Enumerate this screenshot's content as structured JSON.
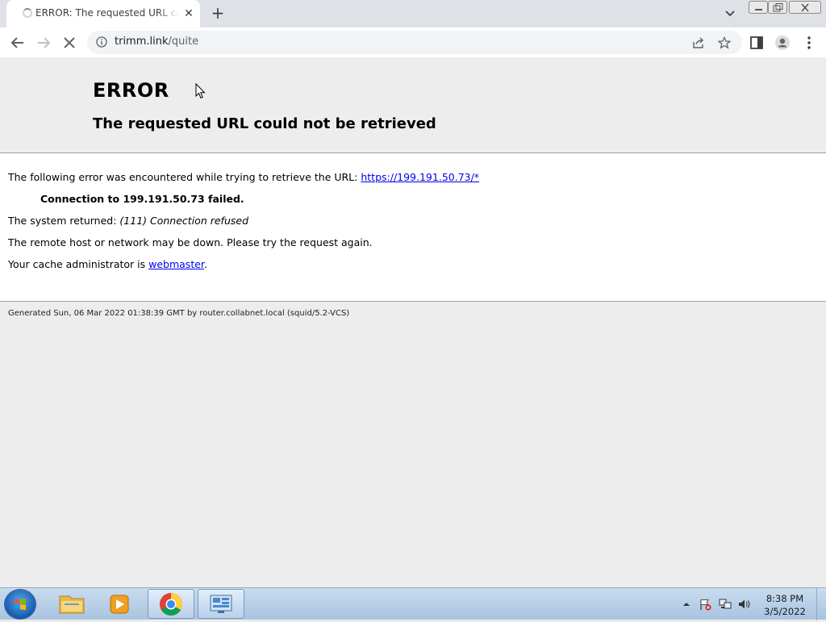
{
  "browser": {
    "tab_title": "ERROR: The requested URL could not be retrieved",
    "url_host": "trimm.link",
    "url_path": "/quite"
  },
  "page": {
    "heading": "ERROR",
    "subheading": "The requested URL could not be retrieved",
    "line1_prefix": "The following error was encountered while trying to retrieve the URL: ",
    "line1_link": "https://199.191.50.73/*",
    "line2": "Connection to 199.191.50.73 failed.",
    "line3_prefix": "The system returned: ",
    "line3_value": "(111) Connection refused",
    "line4": "The remote host or network may be down. Please try the request again.",
    "line5_prefix": "Your cache administrator is ",
    "line5_link": "webmaster",
    "line5_suffix": ".",
    "footer": "Generated Sun, 06 Mar 2022 01:38:39 GMT by router.collabnet.local (squid/5.2-VCS)"
  },
  "taskbar": {
    "apps": [
      "windows-explorer-icon",
      "media-player-icon",
      "chrome-icon",
      "control-panel-icon"
    ],
    "time": "8:38 PM",
    "date": "3/5/2022"
  },
  "colors": {
    "link": "#0000ee",
    "page_bg": "#ededed",
    "tabbar_bg": "#dee1e6"
  }
}
